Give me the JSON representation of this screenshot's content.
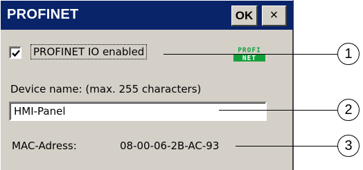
{
  "dialog": {
    "title": "PROFINET",
    "ok_label": "OK",
    "close_glyph": "×"
  },
  "profinet_checkbox": {
    "checked": true,
    "label": "PROFINET IO enabled"
  },
  "logo": {
    "line1": "PROFI",
    "line2": "NET",
    "colors": {
      "green": "#14a03c",
      "white": "#ffffff"
    }
  },
  "device_name": {
    "label": "Device name: (max. 255 characters)",
    "value": "HMI-Panel"
  },
  "mac": {
    "label": "MAC-Adress:",
    "value": "08-00-06-2B-AC-93"
  },
  "callouts": [
    "1",
    "2",
    "3"
  ],
  "colors": {
    "titlebar": "#0a246a",
    "dialog_bg": "#d4d0c8"
  }
}
